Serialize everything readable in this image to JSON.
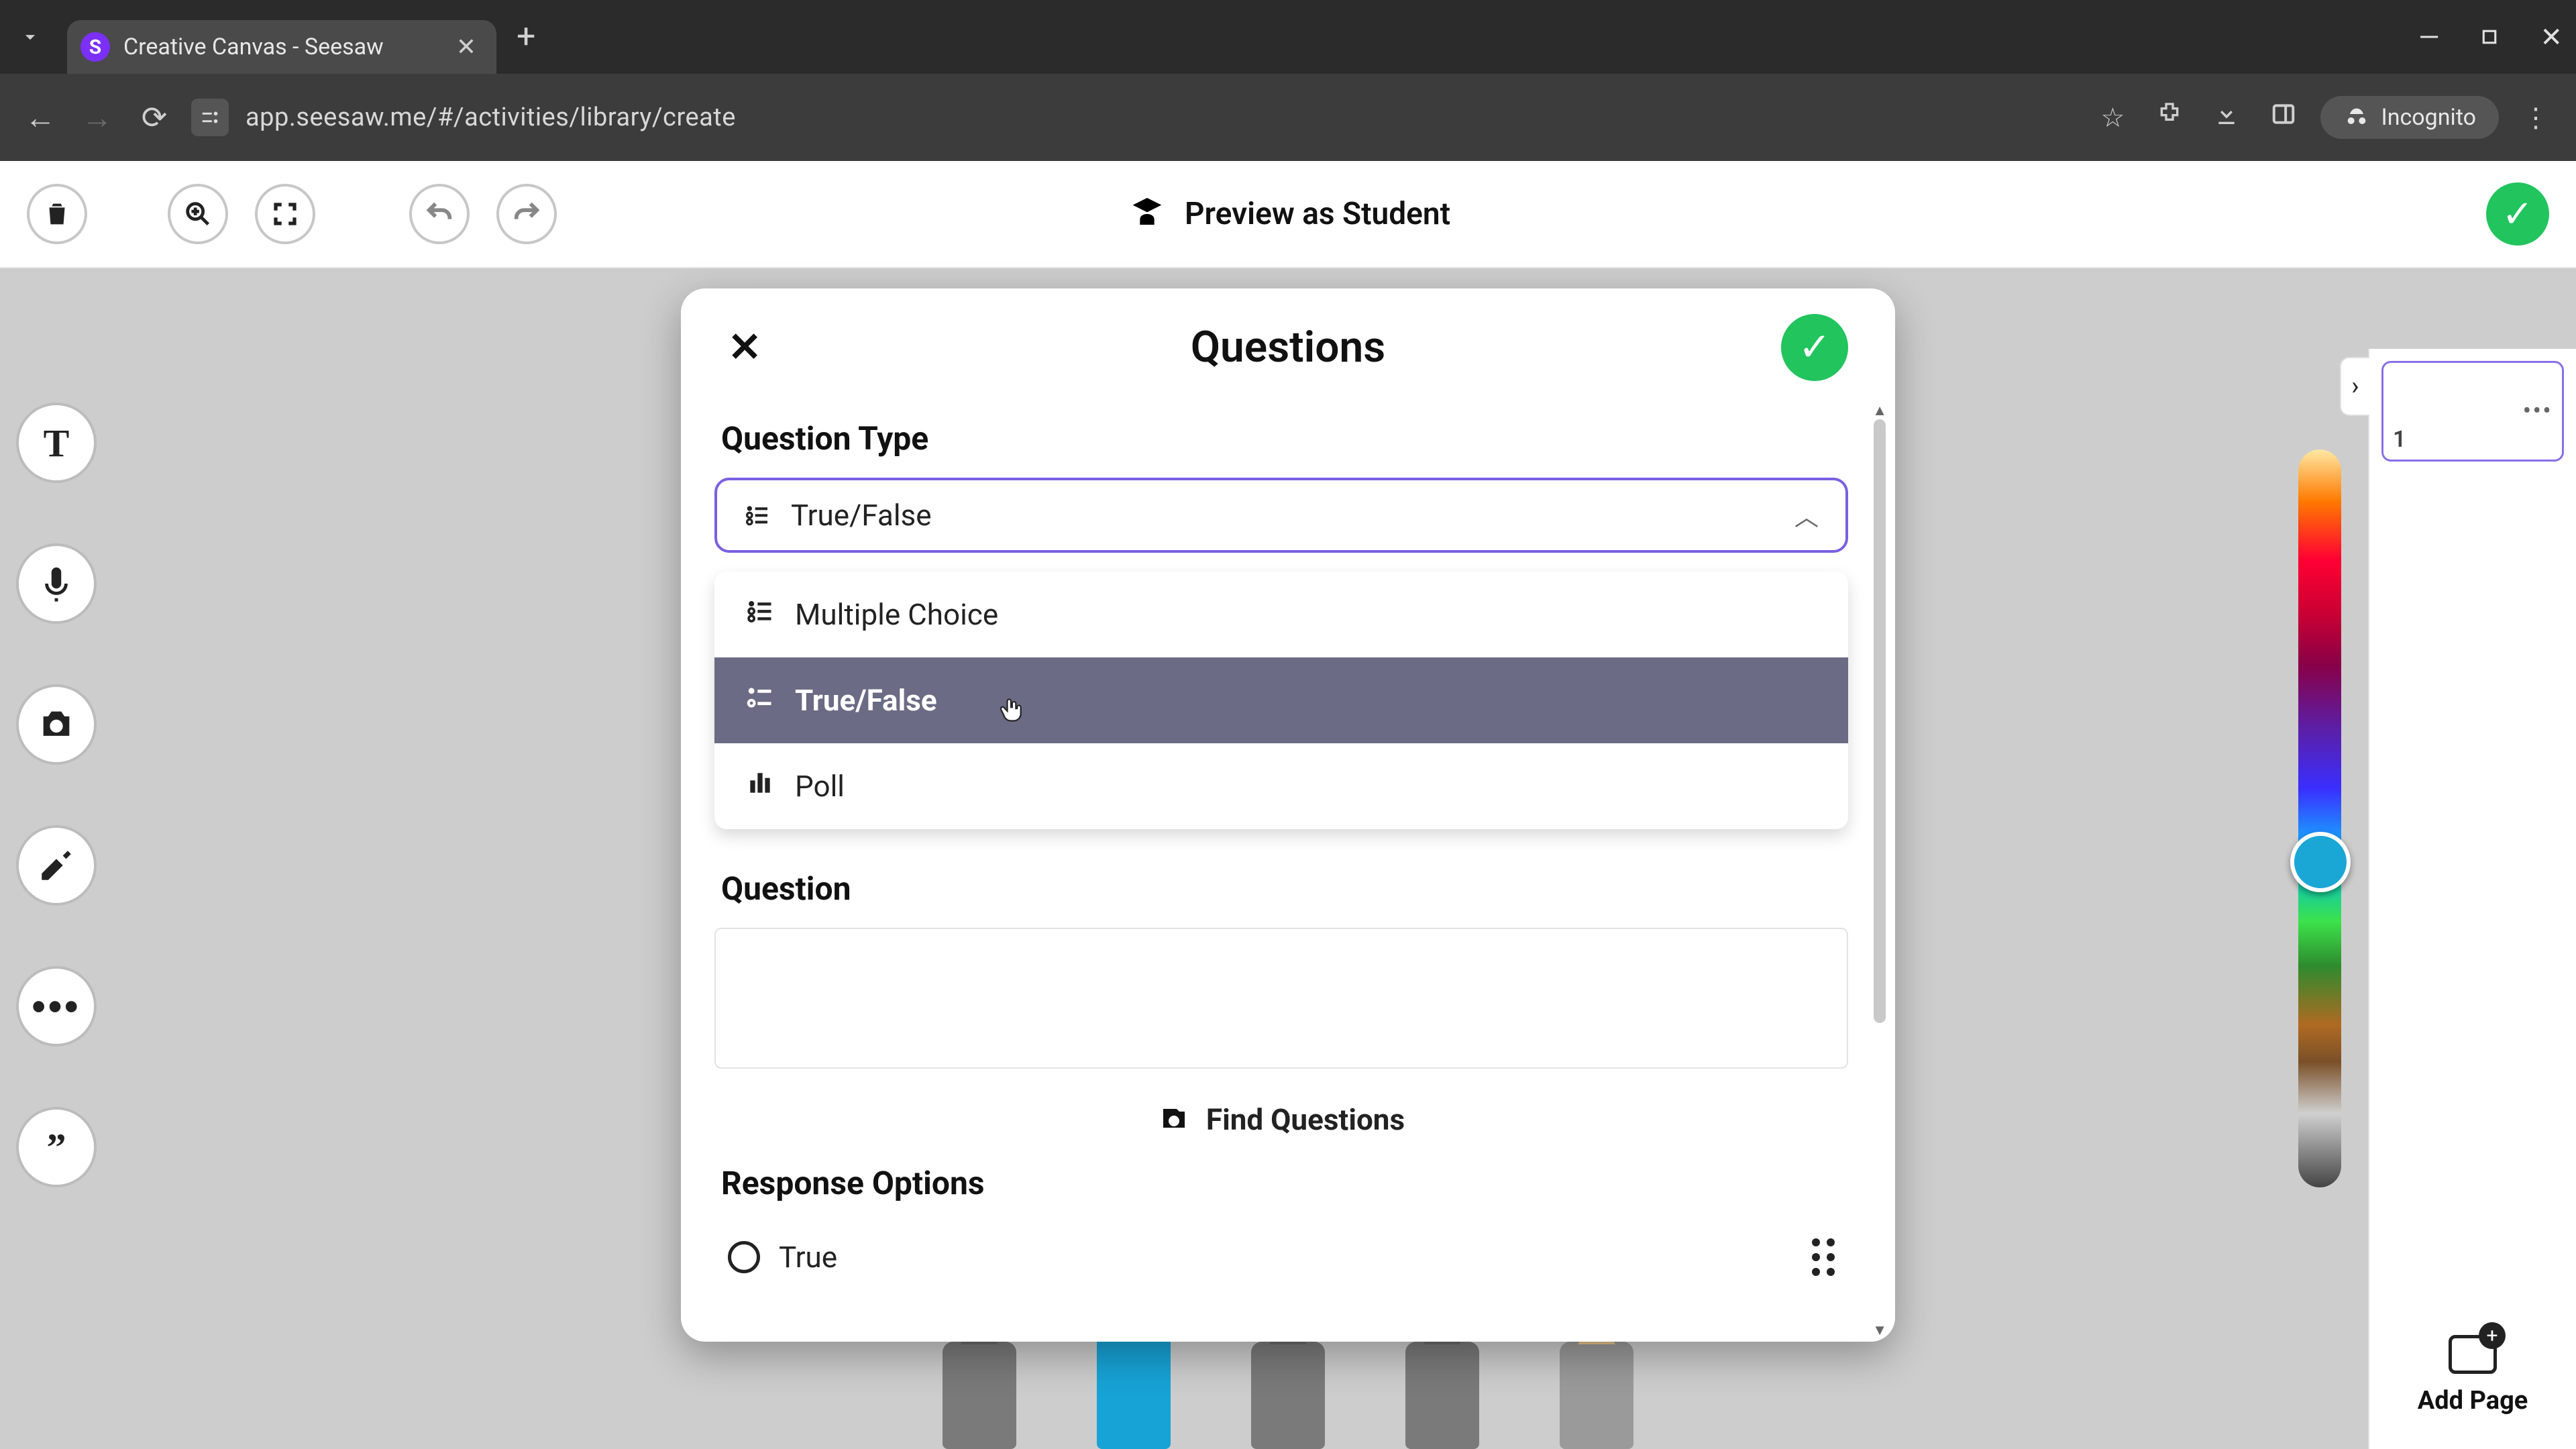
{
  "browser": {
    "tab_title": "Creative Canvas - Seesaw",
    "url": "app.seesaw.me/#/activities/library/create",
    "incognito_label": "Incognito"
  },
  "topbar": {
    "preview_label": "Preview as Student"
  },
  "pages": {
    "thumb_number": "1",
    "add_page_label": "Add Page"
  },
  "modal": {
    "title": "Questions",
    "question_type_label": "Question Type",
    "selected_type": "True/False",
    "options": {
      "multiple_choice": "Multiple Choice",
      "true_false": "True/False",
      "poll": "Poll"
    },
    "question_label": "Question",
    "find_questions_label": "Find Questions",
    "response_options_label": "Response Options",
    "response_true": "True"
  }
}
